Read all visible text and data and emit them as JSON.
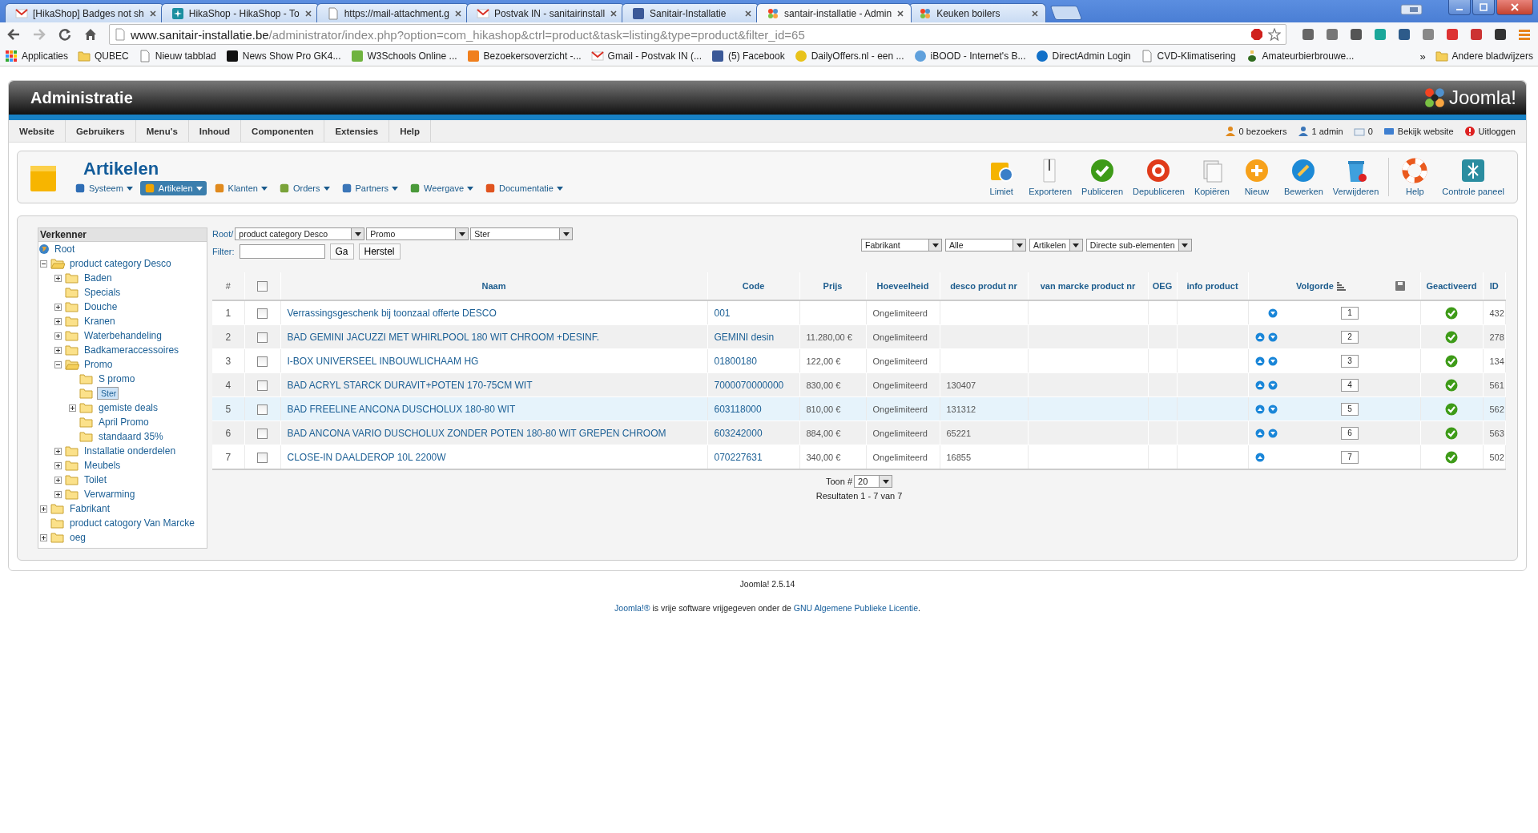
{
  "browser": {
    "tabs": [
      {
        "title": "[HikaShop] Badges not sh",
        "selected": false
      },
      {
        "title": "HikaShop - HikaShop - To",
        "selected": false
      },
      {
        "title": "https://mail-attachment.g",
        "selected": false
      },
      {
        "title": "Postvak IN - sanitairinstall",
        "selected": false
      },
      {
        "title": "Sanitair-Installatie",
        "selected": false
      },
      {
        "title": "santair-installatie - Admin",
        "selected": true
      },
      {
        "title": "Keuken boilers",
        "selected": false
      }
    ],
    "address_host": "www.sanitair-installatie.be",
    "address_path": "/administrator/index.php?option=com_hikashop&ctrl=product&task=listing&type=product&filter_id=65",
    "bookmarks": [
      "Applicaties",
      "QUBEC",
      "Nieuw tabblad",
      "News Show Pro GK4...",
      "W3Schools Online ...",
      "Bezoekersoverzicht -...",
      "Gmail - Postvak IN (...",
      "(5) Facebook",
      "DailyOffers.nl - een ...",
      "iBOOD - Internet's B...",
      "DirectAdmin Login",
      "CVD-Klimatisering",
      "Amateurbierbrouwe..."
    ],
    "more": "»",
    "other_bookmarks": "Andere bladwijzers"
  },
  "admin": {
    "title": "Administratie",
    "logo": "Joomla!",
    "menu": [
      "Website",
      "Gebruikers",
      "Menu's",
      "Inhoud",
      "Componenten",
      "Extensies",
      "Help"
    ],
    "status": [
      "0 bezoekers",
      "1 admin",
      "0",
      "Bekijk website",
      "Uitloggen"
    ]
  },
  "page": {
    "title": "Artikelen",
    "submenu": [
      {
        "label": "Systeem",
        "selected": false
      },
      {
        "label": "Artikelen",
        "selected": true
      },
      {
        "label": "Klanten",
        "selected": false
      },
      {
        "label": "Orders",
        "selected": false
      },
      {
        "label": "Partners",
        "selected": false
      },
      {
        "label": "Weergave",
        "selected": false
      },
      {
        "label": "Documentatie",
        "selected": false
      }
    ],
    "toolbar_groups": [
      [
        "Limiet",
        "Exporteren",
        "Publiceren",
        "Depubliceren",
        "Kopiëren",
        "Nieuw",
        "Bewerken",
        "Verwijderen"
      ],
      [
        "Help",
        "Controle paneel"
      ]
    ]
  },
  "explorer": {
    "title": "Verkenner",
    "root": "Root",
    "nodes": [
      {
        "label": "product category Desco",
        "kind": "branch",
        "expanded": true,
        "selected": false,
        "children": [
          {
            "label": "Baden",
            "kind": "branch",
            "expanded": false,
            "selected": false
          },
          {
            "label": "Specials",
            "kind": "leaf",
            "selected": false
          },
          {
            "label": "Douche",
            "kind": "branch",
            "expanded": false,
            "selected": false
          },
          {
            "label": "Kranen",
            "kind": "branch",
            "expanded": false,
            "selected": false
          },
          {
            "label": "Waterbehandeling",
            "kind": "branch",
            "expanded": false,
            "selected": false
          },
          {
            "label": "Badkameraccessoires",
            "kind": "branch",
            "expanded": false,
            "selected": false
          },
          {
            "label": "Promo",
            "kind": "branch",
            "expanded": true,
            "selected": false,
            "children": [
              {
                "label": "S promo",
                "kind": "leaf",
                "selected": false
              },
              {
                "label": "Ster",
                "kind": "leaf",
                "selected": true
              },
              {
                "label": "gemiste deals",
                "kind": "branch",
                "expanded": false,
                "selected": false
              },
              {
                "label": "April Promo",
                "kind": "leaf",
                "selected": false
              },
              {
                "label": "standaard 35%",
                "kind": "leaf",
                "selected": false
              }
            ]
          },
          {
            "label": "Installatie onderdelen",
            "kind": "branch",
            "expanded": false,
            "selected": false
          },
          {
            "label": "Meubels",
            "kind": "branch",
            "expanded": false,
            "selected": false
          },
          {
            "label": "Toilet",
            "kind": "branch",
            "expanded": false,
            "selected": false
          },
          {
            "label": "Verwarming",
            "kind": "branch",
            "expanded": false,
            "selected": false
          }
        ]
      },
      {
        "label": "Fabrikant",
        "kind": "branch",
        "expanded": false,
        "selected": false
      },
      {
        "label": "product catogory Van Marcke",
        "kind": "leaf",
        "selected": false
      },
      {
        "label": "oeg",
        "kind": "branch",
        "expanded": false,
        "selected": false
      }
    ]
  },
  "filters": {
    "path_label": "Root/",
    "category_selects": [
      "product category Desco",
      "Promo",
      "Ster"
    ],
    "filter_label": "Filter:",
    "go": "Ga",
    "reset": "Herstel",
    "selects": [
      "Fabrikant",
      "Alle",
      "Artikelen",
      "Directe sub-elementen"
    ]
  },
  "table": {
    "all_checked": false,
    "columns": [
      "#",
      "Naam",
      "Code",
      "Prijs",
      "Hoeveelheid",
      "desco produt nr",
      "van marcke product nr",
      "OEG",
      "info product",
      "Volgorde",
      "Geactiveerd",
      "ID"
    ],
    "rows": [
      {
        "num": "1",
        "checked": false,
        "name": "Verrassingsgeschenk bij toonzaal offerte DESCO",
        "code": "001",
        "qty": "Ongelimiteerd",
        "move_up": false,
        "move_down": true,
        "order": "1",
        "published": true,
        "id": "432",
        "highlighted": false
      },
      {
        "num": "2",
        "checked": false,
        "name": "BAD GEMINI JACUZZI MET WHIRLPOOL 180 WIT CHROOM +DESINF.",
        "code": "GEMINI desin",
        "price": "11.280,00 €",
        "qty": "Ongelimiteerd",
        "move_up": true,
        "move_down": true,
        "order": "2",
        "published": true,
        "id": "278",
        "highlighted": false
      },
      {
        "num": "3",
        "checked": false,
        "name": "I-BOX UNIVERSEEL INBOUWLICHAAM HG",
        "code": "01800180",
        "price": "122,00 €",
        "qty": "Ongelimiteerd",
        "move_up": true,
        "move_down": true,
        "order": "3",
        "published": true,
        "id": "134",
        "highlighted": false
      },
      {
        "num": "4",
        "checked": false,
        "name": "BAD ACRYL STARCK DURAVIT+POTEN 170-75CM WIT",
        "code": "7000070000000",
        "price": "830,00 €",
        "qty": "Ongelimiteerd",
        "desco": "130407",
        "move_up": true,
        "move_down": true,
        "order": "4",
        "published": true,
        "id": "561",
        "highlighted": false
      },
      {
        "num": "5",
        "checked": false,
        "name": "BAD FREELINE ANCONA DUSCHOLUX 180-80 WIT",
        "code": "603118000",
        "price": "810,00 €",
        "qty": "Ongelimiteerd",
        "desco": "131312",
        "move_up": true,
        "move_down": true,
        "order": "5",
        "published": true,
        "id": "562",
        "highlighted": true
      },
      {
        "num": "6",
        "checked": false,
        "name": "BAD ANCONA VARIO DUSCHOLUX ZONDER POTEN 180-80 WIT GREPEN CHROOM",
        "code": "603242000",
        "price": "884,00 €",
        "qty": "Ongelimiteerd",
        "desco": "65221",
        "move_up": true,
        "move_down": true,
        "order": "6",
        "published": true,
        "id": "563",
        "highlighted": false
      },
      {
        "num": "7",
        "checked": false,
        "name": "CLOSE-IN DAALDEROP 10L 2200W",
        "code": "070227631",
        "price": "340,00 €",
        "qty": "Ongelimiteerd",
        "desco": "16855",
        "move_up": true,
        "move_down": false,
        "order": "7",
        "published": true,
        "id": "502",
        "highlighted": false
      }
    ]
  },
  "pagination": {
    "label": "Toon #",
    "value": "20",
    "results": "Resultaten 1 - 7 van 7"
  },
  "footer": {
    "version": "Joomla! 2.5.14",
    "brand": "Joomla!®",
    "text": " is vrije software vrijgegeven onder de ",
    "link": "GNU Algemene Publieke Licentie",
    "end": "."
  }
}
